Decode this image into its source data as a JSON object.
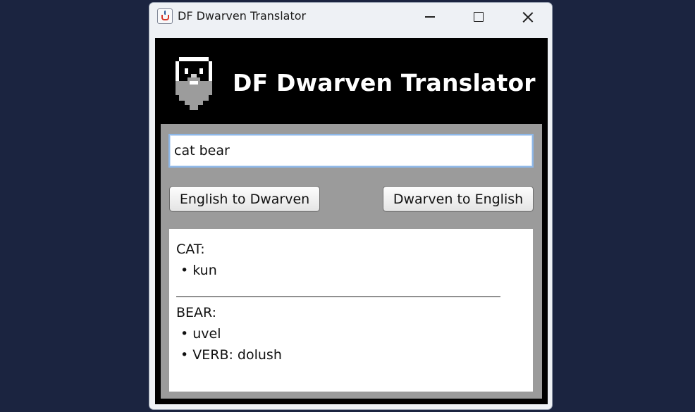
{
  "window": {
    "title": "DF Dwarven Translator"
  },
  "header": {
    "heading": "DF Dwarven Translator",
    "icon": "dwarf-face-icon"
  },
  "search": {
    "value": "cat bear"
  },
  "buttons": {
    "english_to_dwarven": "English to Dwarven",
    "dwarven_to_english": "Dwarven to English"
  },
  "results": {
    "entries": [
      {
        "word": "CAT:",
        "translations": [
          "• kun"
        ]
      },
      {
        "word": "BEAR:",
        "translations": [
          "• uvel",
          "• VERB: dolush"
        ]
      }
    ]
  },
  "colors": {
    "desktop": "#1b2440",
    "header_bg": "#000000",
    "panel_bg": "#9b9b9b",
    "input_focus": "#8db7e8"
  }
}
